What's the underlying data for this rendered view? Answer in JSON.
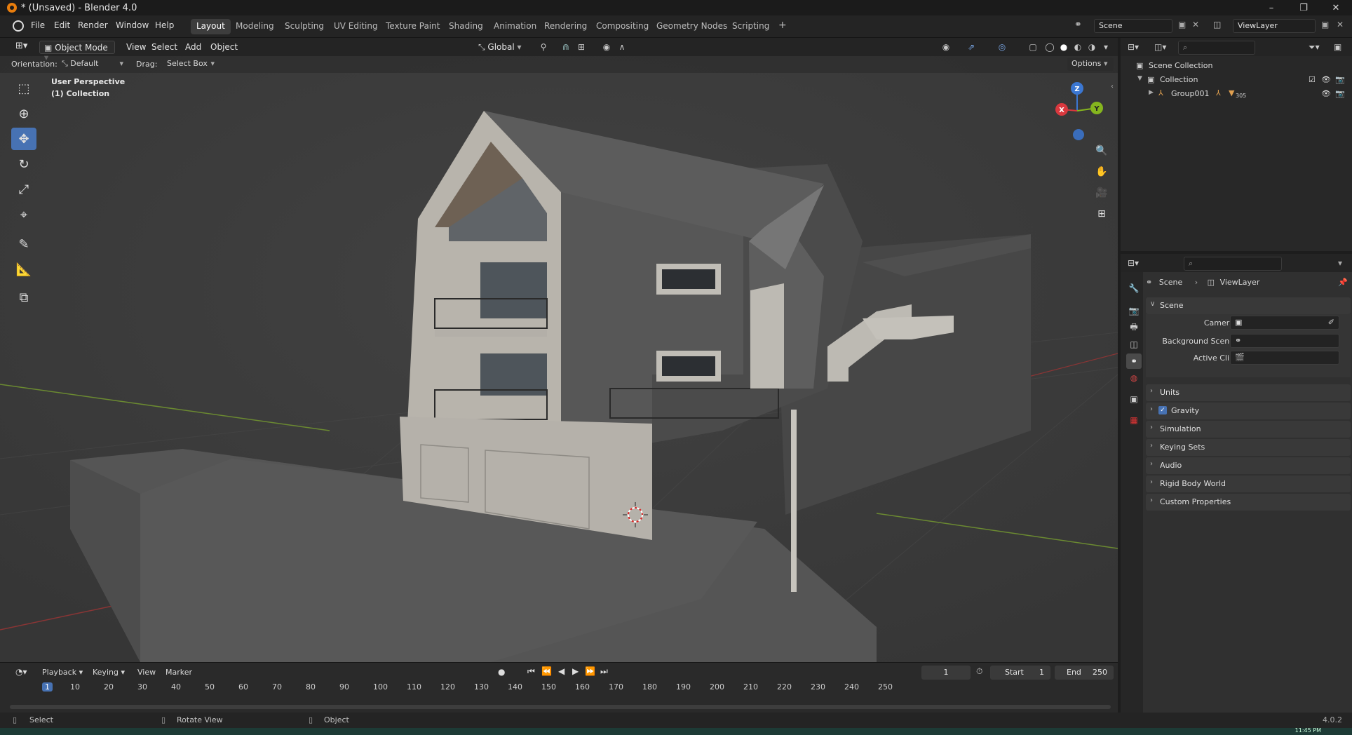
{
  "window": {
    "title": "* (Unsaved) - Blender 4.0",
    "minimize": "–",
    "restore": "❐",
    "close": "✕"
  },
  "menu": {
    "file": "File",
    "edit": "Edit",
    "render": "Render",
    "window": "Window",
    "help": "Help"
  },
  "workspaces": [
    {
      "label": "Layout",
      "active": true
    },
    {
      "label": "Modeling"
    },
    {
      "label": "Sculpting"
    },
    {
      "label": "UV Editing"
    },
    {
      "label": "Texture Paint"
    },
    {
      "label": "Shading"
    },
    {
      "label": "Animation"
    },
    {
      "label": "Rendering"
    },
    {
      "label": "Compositing"
    },
    {
      "label": "Geometry Nodes"
    },
    {
      "label": "Scripting"
    }
  ],
  "add_workspace": "+",
  "scene_selector": {
    "scene": "Scene",
    "view_layer": "ViewLayer"
  },
  "viewport": {
    "mode": "Object Mode",
    "menus": {
      "view": "View",
      "select": "Select",
      "add": "Add",
      "object": "Object"
    },
    "transform_orientation": "Global",
    "orientation_label": "Orientation:",
    "orientation_value": "Default",
    "drag_label": "Drag:",
    "drag_value": "Select Box",
    "options": "Options",
    "overlay_title": "User Perspective",
    "overlay_collection": "(1) Collection",
    "gizmo": {
      "x": "X",
      "y": "Y",
      "z": "Z"
    }
  },
  "timeline": {
    "menus": {
      "playback": "Playback",
      "keying": "Keying",
      "view": "View",
      "marker": "Marker"
    },
    "current_frame": "1",
    "start_label": "Start",
    "start": "1",
    "end_label": "End",
    "end": "250",
    "ticks": [
      "1",
      "10",
      "20",
      "30",
      "40",
      "50",
      "60",
      "70",
      "80",
      "90",
      "100",
      "110",
      "120",
      "130",
      "140",
      "150",
      "160",
      "170",
      "180",
      "190",
      "200",
      "210",
      "220",
      "230",
      "240",
      "250"
    ]
  },
  "statusbar": {
    "select": "Select",
    "rotate": "Rotate View",
    "object": "Object",
    "version": "4.0.2",
    "clock": "11:45 PM"
  },
  "outliner": {
    "scene_collection": "Scene Collection",
    "collection": "Collection",
    "group": "Group001",
    "group_count": "305"
  },
  "properties": {
    "breadcrumb_scene": "Scene",
    "breadcrumb_layer": "ViewLayer",
    "panel_scene": "Scene",
    "camera_label": "Camera",
    "background_label": "Background Scene",
    "clip_label": "Active Clip",
    "panels": [
      "Units",
      "Gravity",
      "Simulation",
      "Keying Sets",
      "Audio",
      "Rigid Body World",
      "Custom Properties"
    ]
  },
  "colors": {
    "accent": "#4772b3",
    "x_axis": "#d9383e",
    "y_axis": "#85b51e",
    "z_axis": "#3b77d2"
  }
}
